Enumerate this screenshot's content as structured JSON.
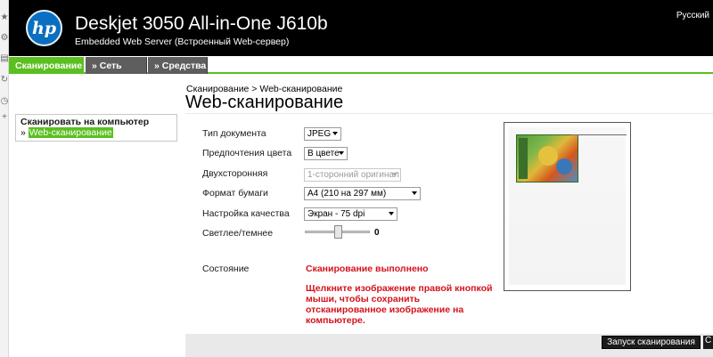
{
  "header": {
    "logo_text": "hp",
    "title": "Deskjet 3050 All-in-One J610b",
    "subtitle": "Embedded Web Server (Встроенный Web-сервер)",
    "language": "Русский"
  },
  "tabs": [
    {
      "label": "Сканирование"
    },
    {
      "label": "» Сеть"
    },
    {
      "label": "» Средства"
    }
  ],
  "sidebar": {
    "heading": "Сканировать на компьютер",
    "bullet": "»",
    "item": "Web-сканирование"
  },
  "breadcrumb": "Сканирование > Web-сканирование",
  "page_title": "Web-сканирование",
  "form": {
    "doc_type": {
      "label": "Тип документа",
      "value": "JPEG"
    },
    "color": {
      "label": "Предпочтения цвета",
      "value": "В цвете"
    },
    "duplex": {
      "label": "Двухсторонняя",
      "value": "1-сторонний оригинал"
    },
    "paper": {
      "label": "Формат бумаги",
      "value": "А4 (210 на 297 мм)"
    },
    "quality": {
      "label": "Настройка качества",
      "value": "Экран - 75 dpi"
    },
    "brightness": {
      "label": "Светлее/темнее",
      "value": "0"
    }
  },
  "status": {
    "label": "Состояние",
    "value": "Сканирование выполнено",
    "note": "Щелкните изображение правой кнопкой мыши, чтобы сохранить отсканированное изображение на компьютере."
  },
  "buttons": {
    "start_scan": "Запуск сканирования",
    "partial": "С"
  },
  "colors": {
    "accent_green": "#5bbf21",
    "header_black": "#000000",
    "status_red": "#d4121b"
  }
}
